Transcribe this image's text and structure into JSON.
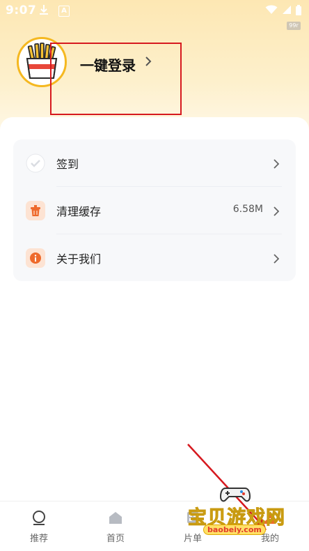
{
  "status_bar": {
    "time": "9:07",
    "badge": "99r"
  },
  "profile": {
    "login_label": "一键登录",
    "chevron": "›"
  },
  "menu": {
    "items": [
      {
        "label": "签到",
        "value": "",
        "icon": "check-circle-icon"
      },
      {
        "label": "清理缓存",
        "value": "6.58M",
        "icon": "trash-icon"
      },
      {
        "label": "关于我们",
        "value": "",
        "icon": "info-icon"
      }
    ]
  },
  "tabs": [
    {
      "label": "推荐",
      "icon": "circle-icon"
    },
    {
      "label": "首页",
      "icon": "home-icon"
    },
    {
      "label": "片单",
      "icon": "film-icon"
    },
    {
      "label": "我的",
      "icon": "user-icon"
    }
  ],
  "watermark": {
    "title": "宝贝游戏网",
    "url": "baobeiy.com"
  },
  "colors": {
    "accent_orange": "#ee6a2c",
    "annotation_red": "#d6191f",
    "avatar_border": "#f5b820"
  }
}
